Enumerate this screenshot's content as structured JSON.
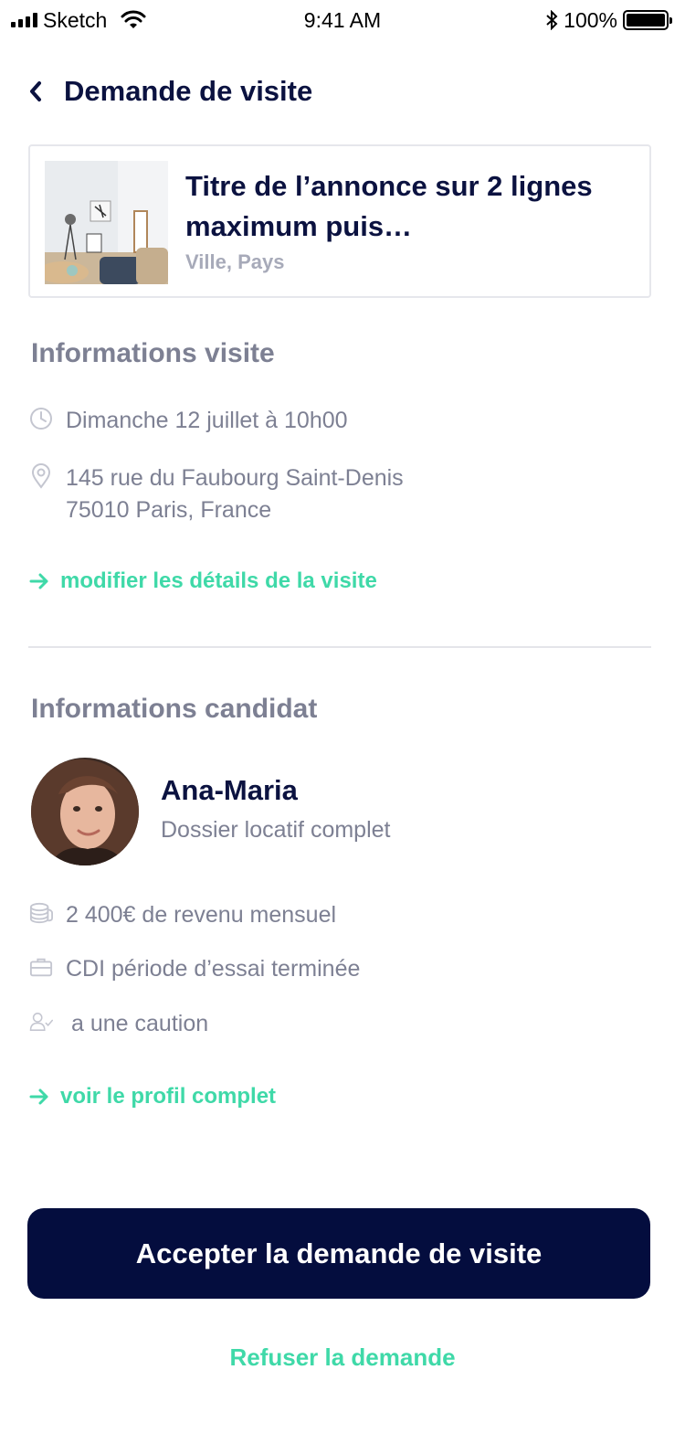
{
  "status_bar": {
    "carrier": "Sketch",
    "time": "9:41 AM",
    "battery_percent": "100%",
    "battery_level": 1.0
  },
  "header": {
    "title": "Demande de visite",
    "back_icon": "chevron-left-icon"
  },
  "listing": {
    "title": "Titre de l’annonce sur 2 lignes maximum puis…",
    "location": "Ville, Pays"
  },
  "visit_info": {
    "section_title": "Informations visite",
    "datetime": "Dimanche 12 juillet à 10h00",
    "address_line1": "145 rue du Faubourg Saint-Denis",
    "address_line2": "75010 Paris, France",
    "edit_link": "modifier les détails de la visite"
  },
  "candidate_info": {
    "section_title": "Informations candidat",
    "name": "Ana-Maria",
    "status": "Dossier locatif complet",
    "income": "2 400€ de revenu mensuel",
    "contract": "CDI  période d’essai terminée",
    "guarantor": "a une caution",
    "profile_link": "voir le profil complet"
  },
  "actions": {
    "accept": "Accepter la demande de visite",
    "refuse": "Refuser la demande"
  },
  "colors": {
    "primary_dark": "#040d3e",
    "accent_green": "#3fd9a8",
    "muted_text": "#7d8093"
  }
}
